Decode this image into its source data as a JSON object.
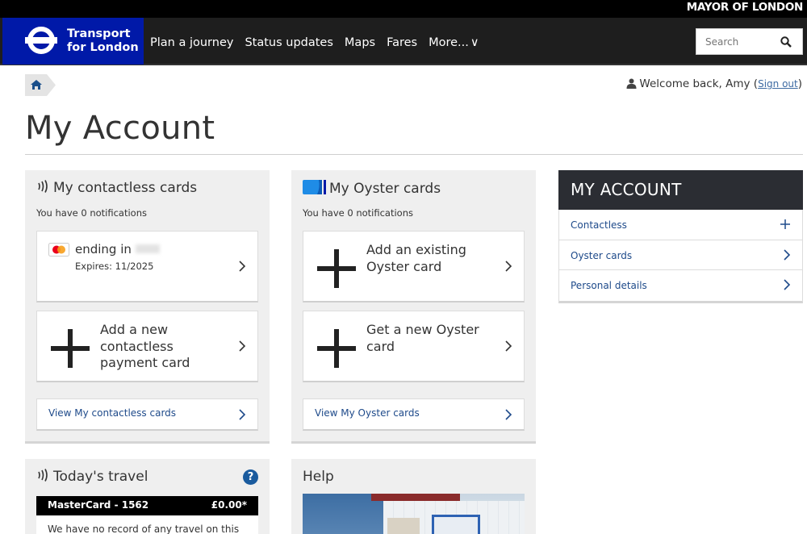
{
  "header": {
    "mayor": "MAYOR OF LONDON",
    "brand_line1": "Transport",
    "brand_line2": "for London",
    "nav": [
      "Plan a journey",
      "Status updates",
      "Maps",
      "Fares",
      "More..."
    ],
    "search_placeholder": "Search"
  },
  "account": {
    "welcome": "Welcome back, Amy (",
    "signout": "Sign out",
    "close_paren": ")",
    "title": "My Account"
  },
  "contactless": {
    "title": "My contactless cards",
    "notifications": "You have 0 notifications",
    "card_ending": "ending in",
    "card_expires": "Expires: 11/2025",
    "add_new": "Add a new contactless payment card",
    "view_link": "View My contactless cards"
  },
  "oyster": {
    "title": "My Oyster cards",
    "notifications": "You have 0 notifications",
    "add_existing": "Add an existing Oyster card",
    "get_new": "Get a new Oyster card",
    "view_link": "View My Oyster cards"
  },
  "sidebar": {
    "heading": "MY ACCOUNT",
    "items": [
      {
        "label": "Contactless",
        "icon": "plus-icon"
      },
      {
        "label": "Oyster cards",
        "icon": "chevron-right-icon"
      },
      {
        "label": "Personal details",
        "icon": "chevron-right-icon"
      }
    ]
  },
  "travel": {
    "title": "Today's travel",
    "card_name": "MasterCard - 1562",
    "amount": "£0.00*",
    "message": "We have no record of any travel on this"
  },
  "help": {
    "title": "Help"
  },
  "colors": {
    "brand_blue": "#0019a8",
    "nav_dark": "#1e1e1e",
    "link_blue": "#1e4a8a",
    "sidebar_head": "#2b2d33"
  }
}
